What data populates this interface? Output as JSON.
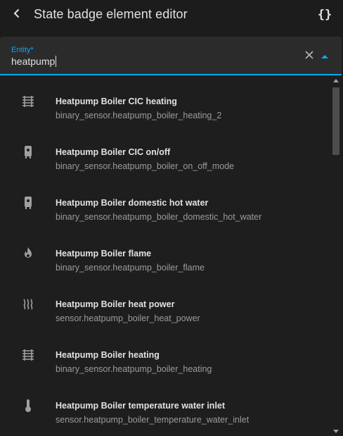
{
  "header": {
    "title": "State badge element editor",
    "back_icon": "chevron-left-icon",
    "code_icon": "code-braces-icon"
  },
  "entity_field": {
    "label": "Entity*",
    "value": "heatpump",
    "clear_icon": "close-icon",
    "toggle_icon": "menu-up-icon"
  },
  "results": [
    {
      "name": "Heatpump Boiler CIC heating",
      "entity_id": "binary_sensor.heatpump_boiler_heating_2",
      "icon": "radiator-icon"
    },
    {
      "name": "Heatpump Boiler CIC on/off",
      "entity_id": "binary_sensor.heatpump_boiler_on_off_mode",
      "icon": "water-boiler-icon"
    },
    {
      "name": "Heatpump Boiler domestic hot water",
      "entity_id": "binary_sensor.heatpump_boiler_domestic_hot_water",
      "icon": "water-boiler-icon"
    },
    {
      "name": "Heatpump Boiler flame",
      "entity_id": "binary_sensor.heatpump_boiler_flame",
      "icon": "fire-icon"
    },
    {
      "name": "Heatpump Boiler heat power",
      "entity_id": "sensor.heatpump_boiler_heat_power",
      "icon": "heat-wave-icon"
    },
    {
      "name": "Heatpump Boiler heating",
      "entity_id": "binary_sensor.heatpump_boiler_heating",
      "icon": "radiator-icon"
    },
    {
      "name": "Heatpump Boiler temperature water inlet",
      "entity_id": "sensor.heatpump_boiler_temperature_water_inlet",
      "icon": "thermometer-icon"
    }
  ],
  "colors": {
    "accent": "#03a9f4",
    "background": "#1c1c1c",
    "field_background": "#2b2b2b",
    "primary_text": "#e1e1e1",
    "secondary_text": "#9b9b9b",
    "icon": "#a0a0a0"
  }
}
